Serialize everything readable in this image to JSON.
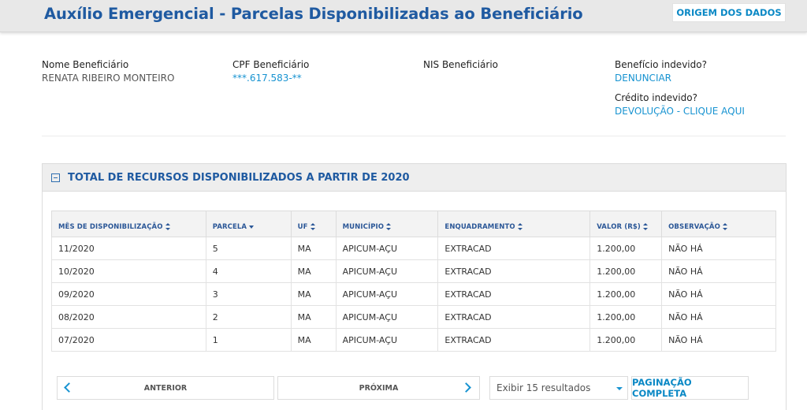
{
  "header": {
    "title": "Auxílio Emergencial - Parcelas Disponibilizadas ao Beneficiário",
    "origin_button": "ORIGEM DOS DADOS"
  },
  "beneficiary": {
    "name_label": "Nome Beneficiário",
    "name_value": "RENATA RIBEIRO MONTEIRO",
    "cpf_label": "CPF Beneficiário",
    "cpf_value": "***.617.583-**",
    "nis_label": "NIS Beneficiário",
    "improper_benefit_label": "Benefício indevido?",
    "improper_benefit_link": "DENUNCIAR",
    "improper_credit_label": "Crédito indevido?",
    "improper_credit_link": "DEVOLUÇÃO - CLIQUE AQUI"
  },
  "panel": {
    "title": "TOTAL DE RECURSOS DISPONIBILIZADOS A PARTIR DE 2020"
  },
  "table": {
    "columns": [
      "MÊS DE DISPONIBILIZAÇÃO",
      "PARCELA",
      "UF",
      "MUNICÍPIO",
      "ENQUADRAMENTO",
      "VALOR (R$)",
      "OBSERVAÇÃO"
    ],
    "rows": [
      [
        "11/2020",
        "5",
        "MA",
        "APICUM-AÇU",
        "EXTRACAD",
        "1.200,00",
        "NÃO HÁ"
      ],
      [
        "10/2020",
        "4",
        "MA",
        "APICUM-AÇU",
        "EXTRACAD",
        "1.200,00",
        "NÃO HÁ"
      ],
      [
        "09/2020",
        "3",
        "MA",
        "APICUM-AÇU",
        "EXTRACAD",
        "1.200,00",
        "NÃO HÁ"
      ],
      [
        "08/2020",
        "2",
        "MA",
        "APICUM-AÇU",
        "EXTRACAD",
        "1.200,00",
        "NÃO HÁ"
      ],
      [
        "07/2020",
        "1",
        "MA",
        "APICUM-AÇU",
        "EXTRACAD",
        "1.200,00",
        "NÃO HÁ"
      ]
    ]
  },
  "pagination": {
    "previous": "ANTERIOR",
    "next": "PRÓXIMA",
    "page_size": "Exibir 15 resultados",
    "full": "PAGINAÇÃO COMPLETA"
  },
  "colors": {
    "title_blue": "#1f5aa1",
    "link_blue": "#1793d1",
    "header_gray": "#e8e8e8"
  }
}
